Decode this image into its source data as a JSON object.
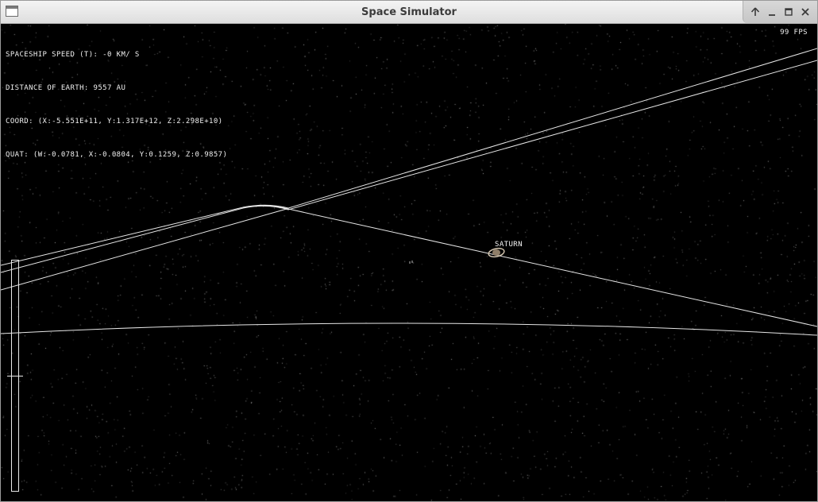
{
  "window": {
    "title": "Space Simulator",
    "controls": [
      "keep-above",
      "minimize",
      "maximize",
      "close"
    ]
  },
  "hud": {
    "speed": "SPACESHIP SPEED (T): -0 KM/ S",
    "distance": "DISTANCE OF EARTH: 9557 AU",
    "coord": "COORD: (X:-5.551E+11, Y:1.317E+12, Z:2.298E+10)",
    "quat": "QUAT: (W:-0.0781, X:-0.0804, Y:0.1259, Z:0.9857)",
    "fps": "99 FPS"
  },
  "planet": {
    "label": "SATURN"
  },
  "throttle": {
    "level": 0.5
  },
  "colors": {
    "background": "#000000",
    "hud_text": "#f0f0f0",
    "orbit_lines": "#e6e6e6",
    "planet": "#c9b9a2"
  }
}
